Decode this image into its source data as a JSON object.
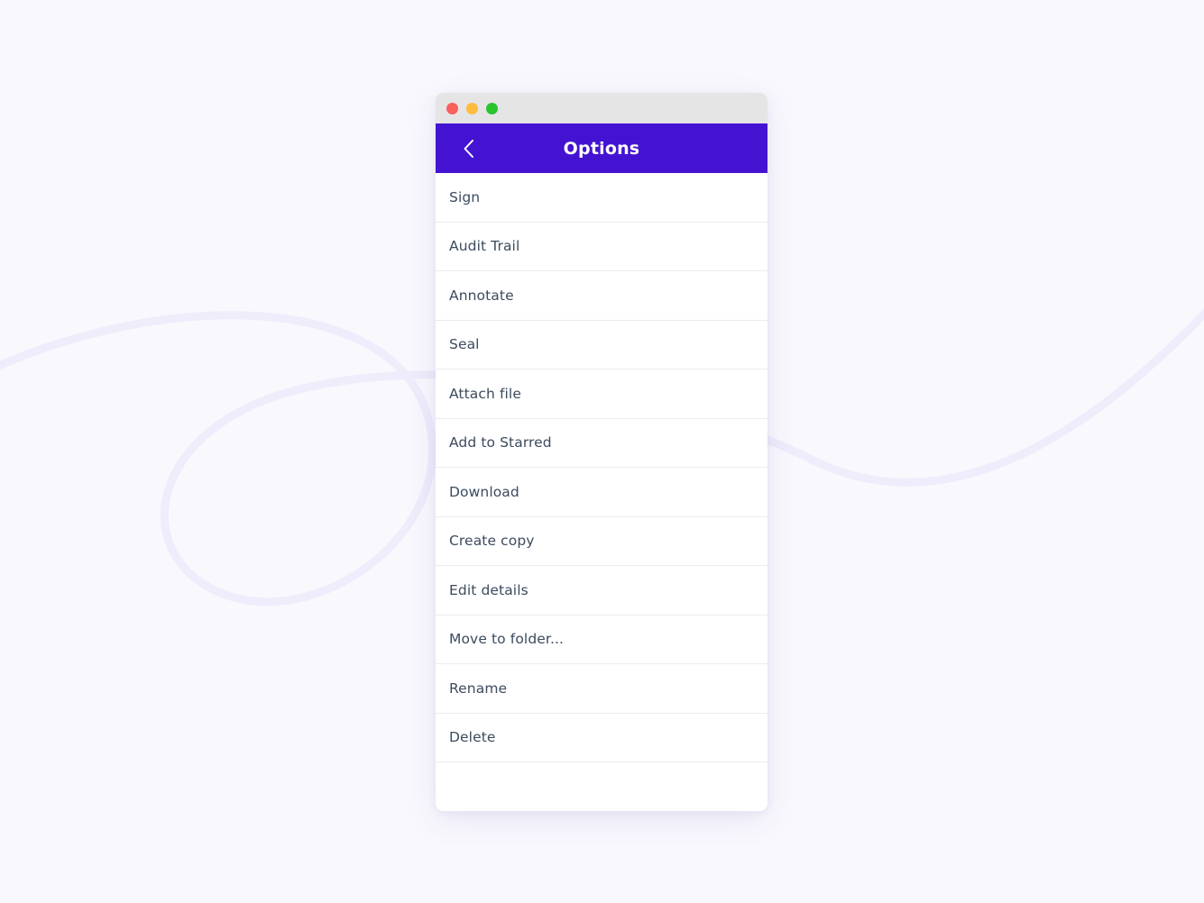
{
  "window": {
    "titlebar": {
      "buttons": [
        {
          "name": "close-button",
          "icon": "traffic-light-close",
          "color": "#f9615d"
        },
        {
          "name": "minimize-button",
          "icon": "traffic-light-minimize",
          "color": "#fdbc40"
        },
        {
          "name": "maximize-button",
          "icon": "traffic-light-maximize",
          "color": "#2ac42f"
        }
      ]
    }
  },
  "header": {
    "title": "Options",
    "back_icon": "chevron-left-icon",
    "background_color": "#4413d2",
    "text_color": "#ffffff"
  },
  "options": [
    {
      "label": "Sign"
    },
    {
      "label": "Audit Trail"
    },
    {
      "label": "Annotate"
    },
    {
      "label": "Seal"
    },
    {
      "label": "Attach file"
    },
    {
      "label": "Add to Starred"
    },
    {
      "label": "Download"
    },
    {
      "label": "Create copy"
    },
    {
      "label": "Edit details"
    },
    {
      "label": "Move to folder..."
    },
    {
      "label": "Rename"
    },
    {
      "label": "Delete"
    }
  ],
  "theme": {
    "page_background": "#f9f8fd",
    "card_background": "#ffffff",
    "titlebar_background": "#e6e5e6",
    "row_text_color": "#3c4b5e",
    "divider_color": "#ececf0",
    "decor_stroke_color": "#efecfb"
  }
}
